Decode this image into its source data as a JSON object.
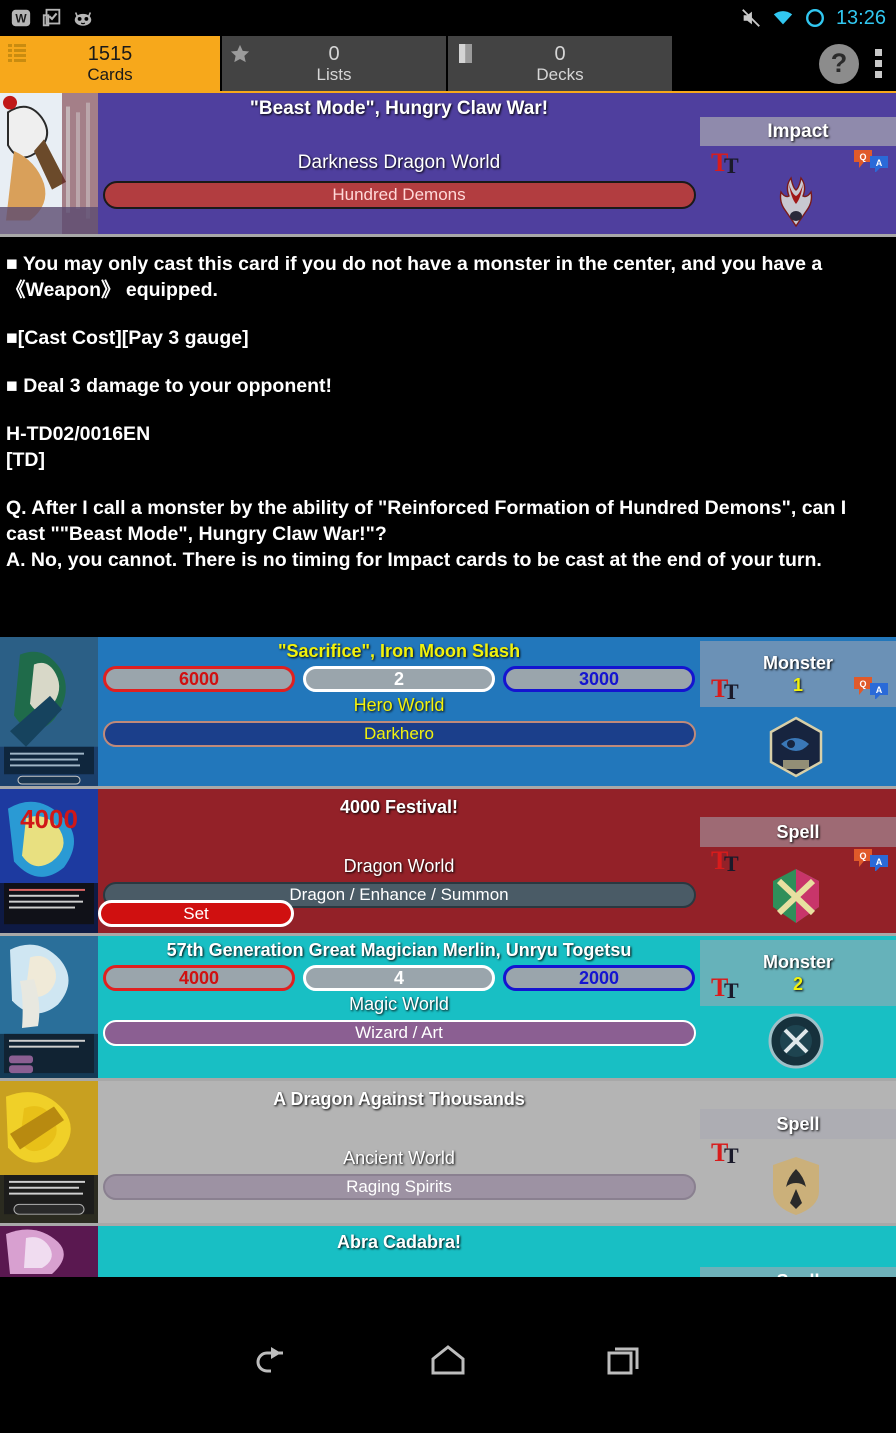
{
  "statusbar": {
    "time": "13:26",
    "left_icons": [
      "w-app-icon",
      "clipboard-check-icon",
      "cyanogenmod-icon"
    ],
    "right_icons": [
      "volume-muted-icon",
      "wifi-icon",
      "circle-sync-icon"
    ]
  },
  "tabbar": {
    "tabs": [
      {
        "icon": "list-lines-icon",
        "count": "1515",
        "label": "Cards",
        "active": true
      },
      {
        "icon": "star-icon",
        "count": "0",
        "label": "Lists",
        "active": false
      },
      {
        "icon": "deck-box-icon",
        "count": "0",
        "label": "Decks",
        "active": false
      }
    ],
    "help_label": "?",
    "overflow_label": "more-options"
  },
  "detail": {
    "title": "\"Beast Mode\", Hungry Claw War!",
    "world": "Darkness Dragon World",
    "attribute": "Hundred Demons",
    "type": "Impact",
    "bg_color": "#4f3f9e",
    "attr_color": "#b23d40",
    "icons": [
      "text-size-icon",
      "qa-bubble-icon",
      "clan-emblem-icon"
    ]
  },
  "card_text": {
    "lines": [
      "■ You may only cast this card if you do not have a monster in the center, and you have a 《Weapon》 equipped.",
      "■[Cast Cost][Pay 3 gauge]",
      "■ Deal 3 damage to your opponent!"
    ],
    "card_id": "H-TD02/0016EN",
    "set_code": "[TD]",
    "qa_question": "Q. After I call a monster by the ability of \"Reinforced Formation of Hundred Demons\", can I cast \"\"Beast Mode\", Hungry Claw War!\"?",
    "qa_answer": "A. No, you cannot. There is no timing for Impact cards to be cast at the end of your turn."
  },
  "rows": [
    {
      "title": "\"Sacrifice\", Iron Moon Slash",
      "title_color": "#f2f20c",
      "bg_color": "#2277bb",
      "power": "6000",
      "crit": "2",
      "defense": "3000",
      "world": "Hero World",
      "world_color": "#f2f20c",
      "attribute": "Darkhero",
      "attr_bg": "#1b3f8b",
      "attr_border": "#c08a7a",
      "attr_color": "#f2f20c",
      "type": "Monster",
      "size": "1",
      "set_button": null,
      "emblem": "hero-world-emblem-icon"
    },
    {
      "title": "4000 Festival!",
      "title_color": "#ffffff",
      "bg_color": "#932128",
      "power": null,
      "crit": null,
      "defense": null,
      "world": "Dragon World",
      "world_color": "#ffffff",
      "attribute": "Dragon / Enhance / Summon",
      "attr_bg": "#4a5b66",
      "attr_border": "#2a3840",
      "attr_color": "#ffffff",
      "type": "Spell",
      "size": null,
      "set_button": "Set",
      "emblem": "dragon-world-emblem-icon"
    },
    {
      "title": "57th Generation Great Magician Merlin, Unryu Togetsu",
      "title_color": "#ffffff",
      "bg_color": "#18bfc4",
      "power": "4000",
      "crit": "4",
      "defense": "2000",
      "world": "Magic World",
      "world_color": "#ffffff",
      "attribute": "Wizard / Art",
      "attr_bg": "#8b5f92",
      "attr_border": "#ffffff",
      "attr_color": "#ffffff",
      "type": "Monster",
      "size": "2",
      "set_button": null,
      "emblem": "magic-world-emblem-icon"
    },
    {
      "title": "A Dragon Against Thousands",
      "title_color": "#ffffff",
      "bg_color": "#b4b4b4",
      "power": null,
      "crit": null,
      "defense": null,
      "world": "Ancient World",
      "world_color": "#ffffff",
      "attribute": "Raging Spirits",
      "attr_bg": "#9d92a3",
      "attr_border": "#8a8090",
      "attr_color": "#ffffff",
      "type": "Spell",
      "size": null,
      "set_button": null,
      "emblem": "ancient-world-emblem-icon"
    }
  ],
  "tail_row": {
    "title": "Abra Cadabra!",
    "title_color": "#ffffff",
    "bg_color": "#18bfc4",
    "type": "Spell"
  },
  "navbar": {
    "buttons": [
      "back-nav-icon",
      "home-nav-icon",
      "recents-nav-icon"
    ]
  }
}
